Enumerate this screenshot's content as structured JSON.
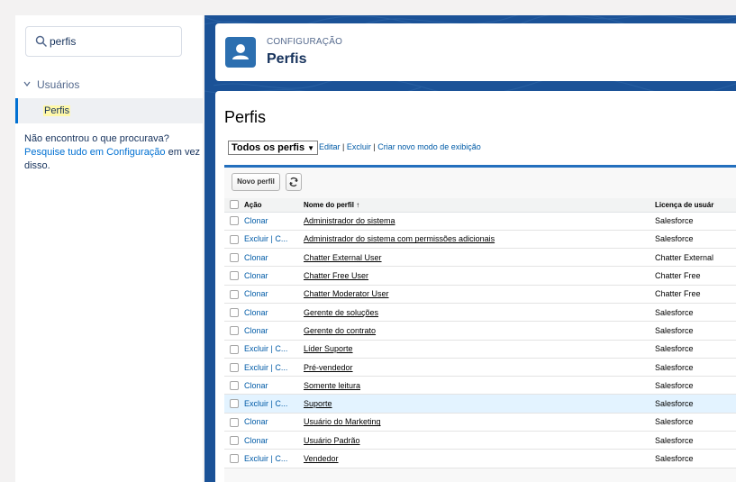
{
  "sidebar": {
    "search": {
      "value": "perfis",
      "placeholder": ""
    },
    "group_label": "Usuários",
    "selected_item": "Perfis",
    "help": {
      "prefix": "Não encontrou o que procurava?",
      "link": "Pesquise tudo em Configuração",
      "suffix": " em vez disso."
    }
  },
  "header": {
    "eyebrow": "CONFIGURAÇÃO",
    "title": "Perfis"
  },
  "content": {
    "page_title": "Perfis",
    "view_select": "Todos os perfis",
    "view_links": {
      "edit": "Editar",
      "delete": "Excluir",
      "create": "Criar novo modo de exibição",
      "sep": " | "
    },
    "toolbar": {
      "new_profile": "Novo perfil"
    },
    "table": {
      "headers": {
        "action": "Ação",
        "name": "Nome do perfil ↑",
        "license": "Licença de usuár"
      },
      "rows": [
        {
          "action": "Clonar",
          "name": "Administrador do sistema",
          "license": "Salesforce",
          "locked": false,
          "highlight": false
        },
        {
          "action": "Excluir | C...",
          "name": "Administrador do sistema com permissões adicionais",
          "license": "Salesforce",
          "locked": false,
          "highlight": false
        },
        {
          "action": "Clonar",
          "name": "Chatter External User",
          "license": "Chatter External",
          "locked": false,
          "highlight": false
        },
        {
          "action": "Clonar",
          "name": "Chatter Free User",
          "license": "Chatter Free",
          "locked": false,
          "highlight": false
        },
        {
          "action": "Clonar",
          "name": "Chatter Moderator User",
          "license": "Chatter Free",
          "locked": false,
          "highlight": false
        },
        {
          "action": "Clonar",
          "name": "Gerente de soluções",
          "license": "Salesforce",
          "locked": false,
          "highlight": false
        },
        {
          "action": "Clonar",
          "name": "Gerente do contrato",
          "license": "Salesforce",
          "locked": false,
          "highlight": false
        },
        {
          "action": "Excluir | C...",
          "name": "Líder Suporte",
          "license": "Salesforce",
          "locked": false,
          "highlight": false
        },
        {
          "action": "Excluir | C...",
          "name": "Pré-vendedor",
          "license": "Salesforce",
          "locked": false,
          "highlight": false
        },
        {
          "action": "Clonar",
          "name": "Somente leitura",
          "license": "Salesforce",
          "locked": false,
          "highlight": false
        },
        {
          "action": "Excluir | C...",
          "name": "Suporte",
          "license": "Salesforce",
          "locked": true,
          "highlight": true
        },
        {
          "action": "Clonar",
          "name": "Usuário do Marketing",
          "license": "Salesforce",
          "locked": false,
          "highlight": false
        },
        {
          "action": "Clonar",
          "name": "Usuário Padrão",
          "license": "Salesforce",
          "locked": false,
          "highlight": false
        },
        {
          "action": "Excluir | C...",
          "name": "Vendedor",
          "license": "Salesforce",
          "locked": false,
          "highlight": false
        }
      ]
    }
  },
  "colors": {
    "brand_blue": "#1b5297",
    "link_blue": "#015ba7",
    "highlight_row": "#e3f3ff"
  }
}
